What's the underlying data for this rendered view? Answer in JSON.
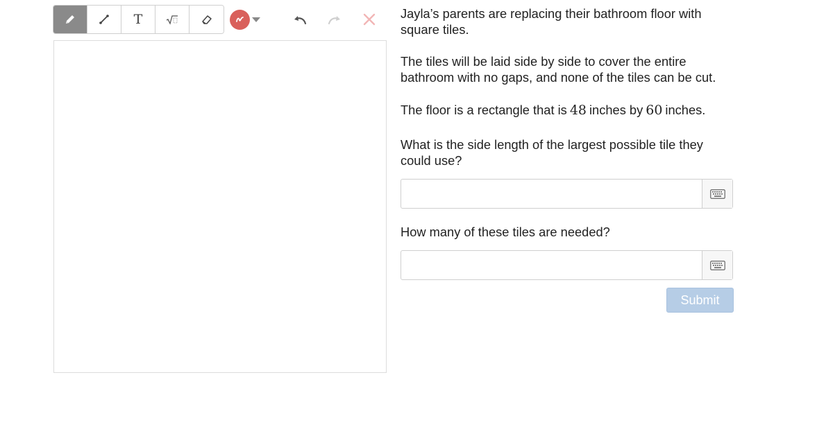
{
  "toolbar": {
    "tools": [
      {
        "name": "pencil",
        "icon": "pencil-icon",
        "active": true
      },
      {
        "name": "line",
        "icon": "line-icon",
        "active": false
      },
      {
        "name": "text",
        "icon": "text-icon",
        "label": "T",
        "active": false
      },
      {
        "name": "math",
        "icon": "square-root-icon",
        "active": false
      },
      {
        "name": "eraser",
        "icon": "eraser-icon",
        "active": false
      }
    ],
    "color_picker": {
      "selected_color": "#d9605b",
      "icon": "color-swatch-icon"
    },
    "undo": {
      "icon": "undo-icon",
      "enabled": true
    },
    "redo": {
      "icon": "redo-icon",
      "enabled": false
    },
    "clear": {
      "icon": "close-icon",
      "enabled": false
    },
    "active_tool_color": "#8a8a8a"
  },
  "question": {
    "intro": "Jayla’s parents are replacing their bathroom floor with square tiles.",
    "constraint": "The tiles will be laid side by side to cover the entire bathroom with no gaps, and none of the tiles can be cut.",
    "dimensions": {
      "prefix": "The floor is a rectangle that is",
      "width": "48",
      "middle": "inches by",
      "length": "60",
      "suffix": "inches."
    },
    "part_a": "What is the side length of the largest possible tile they could use?",
    "part_b": "How many of these tiles are needed?"
  },
  "answers": {
    "part_a_value": "",
    "part_b_value": "",
    "keyboard_icon": "keyboard-icon"
  },
  "submit": {
    "label": "Submit",
    "enabled": false,
    "color": "#b6cde6"
  }
}
